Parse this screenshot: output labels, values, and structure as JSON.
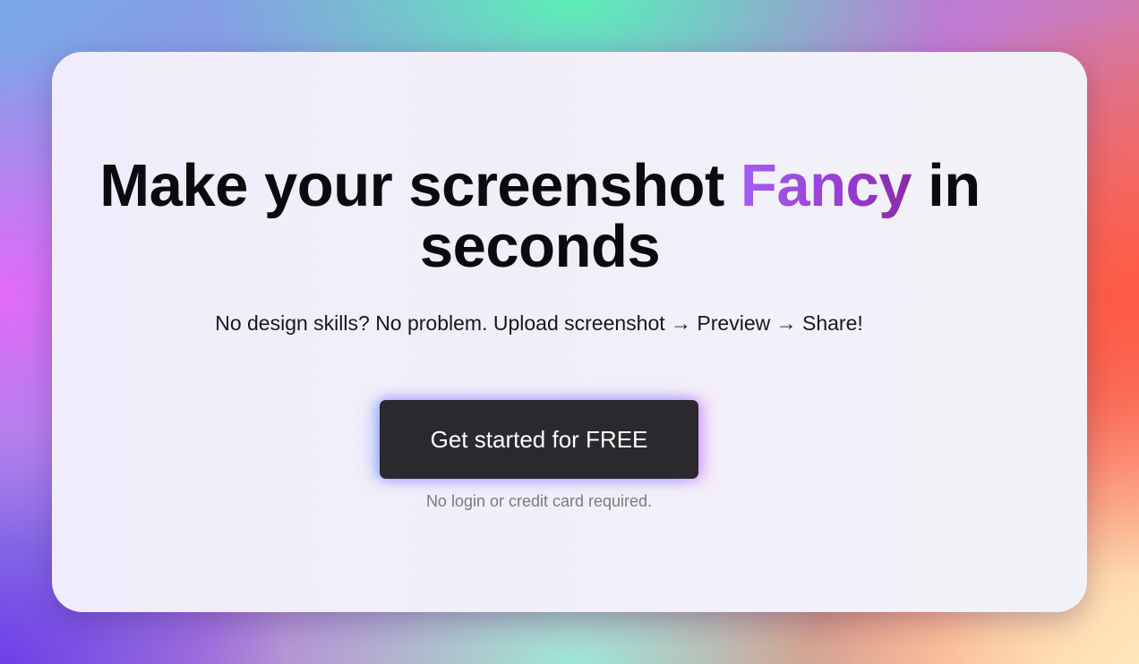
{
  "hero": {
    "title_part1": "Make your screenshot ",
    "title_highlight": "Fancy",
    "title_part2": " in",
    "title_line2": "seconds",
    "subtitle": "No design skills? No problem. Upload screenshot → Preview → Share!",
    "cta_label": "Get started for FREE",
    "note": "No login or credit card required."
  },
  "colors": {
    "highlight_gradient": [
      "#a35ef0",
      "#8a2aa8"
    ],
    "button_bg": "#2b292e",
    "button_text": "#ffffff"
  }
}
